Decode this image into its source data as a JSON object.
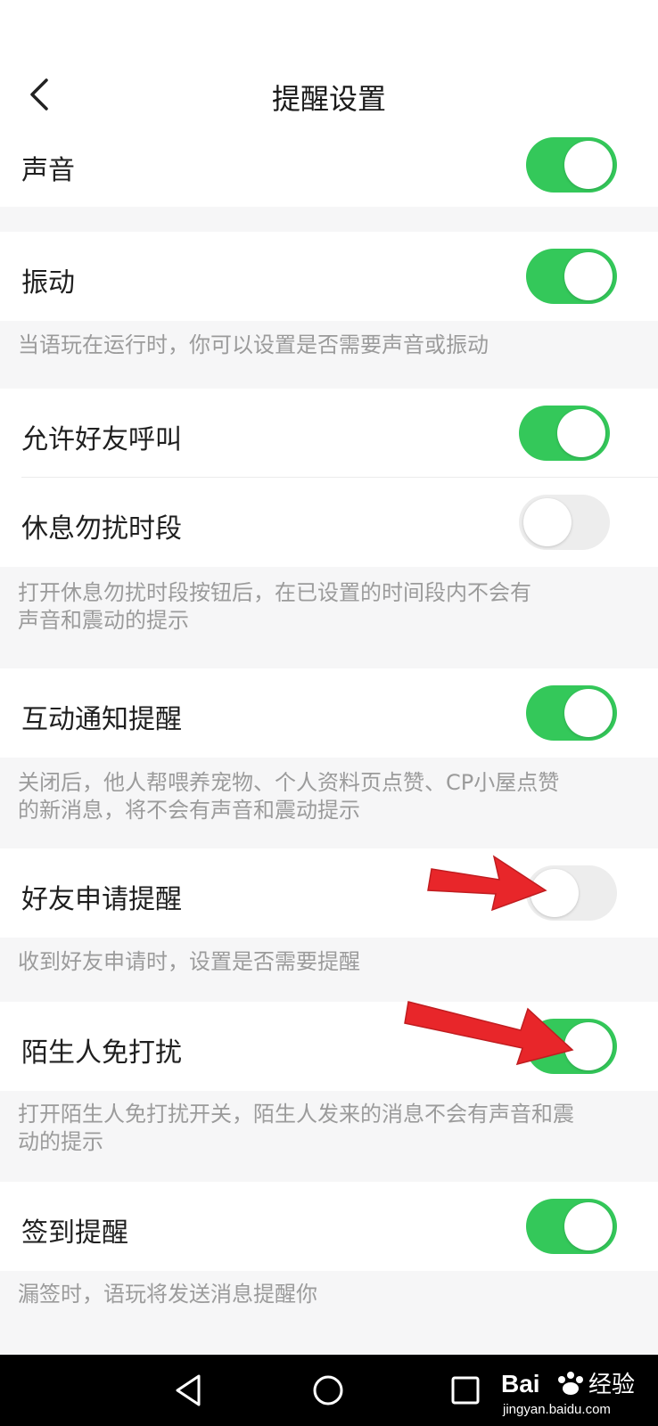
{
  "header": {
    "title": "提醒设置",
    "back_icon": "chevron-left-icon"
  },
  "settings": [
    {
      "label": "声音",
      "on": true
    },
    {
      "label": "振动",
      "on": true,
      "note": "当语玩在运行时，你可以设置是否需要声音或振动"
    },
    {
      "label": "允许好友呼叫",
      "on": true
    },
    {
      "label": "休息勿扰时段",
      "on": false,
      "note_lines": [
        "打开休息勿扰时段按钮后，在已设置的时间段内不会有",
        "声音和震动的提示"
      ]
    },
    {
      "label": "互动通知提醒",
      "on": true,
      "note_lines": [
        "关闭后，他人帮喂养宠物、个人资料页点赞、CP小屋点赞",
        "的新消息，将不会有声音和震动提示"
      ]
    },
    {
      "label": "好友申请提醒",
      "on": false,
      "note": "收到好友申请时，设置是否需要提醒"
    },
    {
      "label": "陌生人免打扰",
      "on": true,
      "note_lines": [
        "打开陌生人免打扰开关，陌生人发来的消息不会有声音和震",
        "动的提示"
      ]
    },
    {
      "label": "签到提醒",
      "on": true,
      "note": "漏签时，语玩将发送消息提醒你"
    }
  ],
  "colors": {
    "toggle_on": "#34c85a",
    "toggle_off": "#ededed",
    "note_text": "#9b9b9b",
    "arrow": "#e8262a"
  },
  "navbar": {
    "icons": [
      "back-triangle-icon",
      "home-circle-icon",
      "recents-square-icon"
    ]
  },
  "watermark": {
    "brand": "Bai",
    "brand2": "经验",
    "domain": "jingyan.baidu.com"
  }
}
